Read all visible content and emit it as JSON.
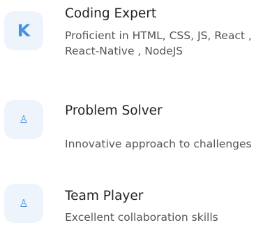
{
  "features": [
    {
      "icon": "letter-k-icon",
      "icon_glyph": "K",
      "title": "Coding Expert",
      "description": "Proficient in HTML, CSS, JS, React , React-Native , NodeJS"
    },
    {
      "icon": "chess-pawn-icon",
      "icon_glyph": "♙",
      "title": "Problem Solver",
      "description": "Innovative approach to challenges"
    },
    {
      "icon": "chess-pawn-icon",
      "icon_glyph": "♙",
      "title": "Team Player",
      "description": "Excellent collaboration skills"
    }
  ],
  "colors": {
    "accent": "#4a90e2",
    "icon_background": "#eef4fc",
    "title_text": "#222222",
    "description_text": "#555555"
  }
}
